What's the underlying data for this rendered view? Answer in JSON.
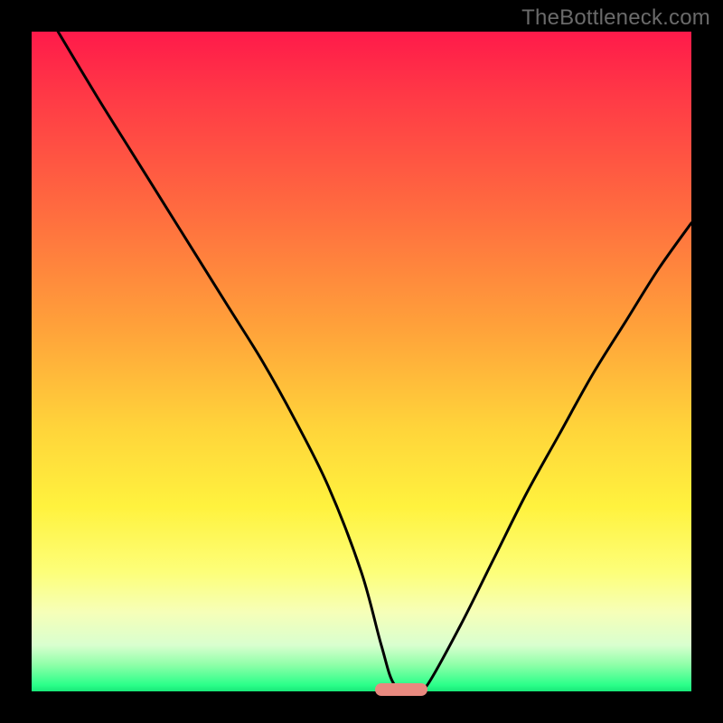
{
  "watermark": "TheBottleneck.com",
  "colors": {
    "background": "#000000",
    "curve": "#000000",
    "marker": "#e8897f",
    "gradient_stops": [
      "#ff1a4a",
      "#ff3a46",
      "#ff6e3f",
      "#ffa23a",
      "#ffd43a",
      "#fff23e",
      "#fdff7a",
      "#f6ffb8",
      "#d9ffcf",
      "#8effa8",
      "#2cff8a",
      "#18e879"
    ]
  },
  "chart_data": {
    "type": "line",
    "title": "",
    "xlabel": "",
    "ylabel": "",
    "xlim": [
      0,
      100
    ],
    "ylim": [
      0,
      100
    ],
    "x": [
      4,
      10,
      15,
      20,
      25,
      30,
      35,
      40,
      45,
      50,
      53,
      55,
      58,
      60,
      65,
      70,
      75,
      80,
      85,
      90,
      95,
      100
    ],
    "values": [
      100,
      90,
      82,
      74,
      66,
      58,
      50,
      41,
      31,
      18,
      7,
      1,
      0,
      1,
      10,
      20,
      30,
      39,
      48,
      56,
      64,
      71
    ],
    "marker": {
      "x_start": 52,
      "x_end": 60,
      "y": 0
    },
    "note": "V-shaped bottleneck curve with minimum near x≈57; values are percent mismatch (y, read from vertical extent) vs. normalized parameter (x)."
  }
}
